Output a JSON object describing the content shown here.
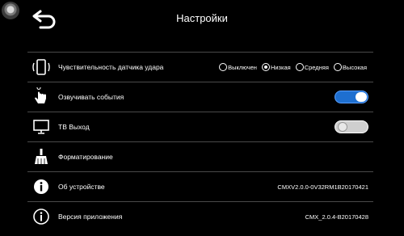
{
  "header": {
    "title": "Настройки"
  },
  "rows": {
    "sensitivity": {
      "label": "Чувствительность датчика удара",
      "options": [
        "Выключен",
        "Низкая",
        "Средняя",
        "Высокая"
      ],
      "selected": "Низкая"
    },
    "events": {
      "label": "Озвучивать события",
      "toggle": "on"
    },
    "tv": {
      "label": "ТВ Выход",
      "toggle": "off"
    },
    "format": {
      "label": "Форматирование"
    },
    "device": {
      "label": "Об устройстве",
      "value": "CMXV2.0.0-0V32RM1B20170421"
    },
    "version": {
      "label": "Версия приложения",
      "value": "CMX_2.0.4-B20170428"
    }
  },
  "icons": {
    "back": "back-arrow-icon",
    "sensitivity": "phone-shake-icon",
    "events": "touch-hand-icon",
    "tv": "monitor-icon",
    "format": "broom-icon",
    "device": "info-icon",
    "version": "info-icon"
  },
  "colors": {
    "toggle_on": "#1e6fd0",
    "toggle_off": "#cfcfcf",
    "divider": "#4a4a4a"
  }
}
